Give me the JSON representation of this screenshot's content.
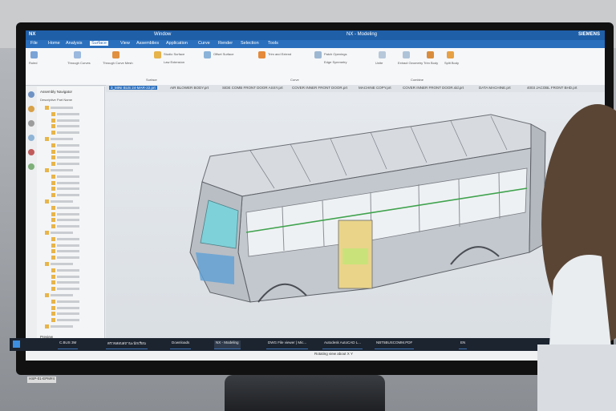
{
  "window": {
    "app_badge": "NX",
    "title": "NX - Modeling",
    "brand": "SIEMENS",
    "window_menu": "Window"
  },
  "menu": [
    "File",
    "Home",
    "Analysis",
    "Surface",
    "View",
    "Assemblies",
    "Application",
    "Curve",
    "Render",
    "Selection",
    "Tools"
  ],
  "ribbon": {
    "groups": [
      "Surface",
      "Curve",
      "Combine"
    ],
    "labels": [
      "Ruled",
      "Through Curves",
      "Through Curve Mesh",
      "Studio Surface",
      "Law Extension",
      "Offset Surface",
      "Trim and Extend",
      "Patch Openings",
      "Edge Symmetry",
      "Unite",
      "Extract Geometry",
      "Trim Body",
      "Split Body"
    ]
  },
  "file_tabs": [
    "3_MINI BUS 24-MAR-22.prt",
    "AIR BLOWER BODY.prt",
    "SIDE COMB FRONT DOOR ASSY.prt",
    "COVER INNER FRONT DOOR.prt",
    "MACHINE COPY.prt",
    "COVER INNER FRONT DOOR.sld.prt",
    "DATA MACHINE.prt",
    "4003 JACOBL FRONT BHD.prt"
  ],
  "nav": {
    "title": "Assembly Navigator",
    "subtitle": "Descriptive Part Name",
    "preview": "Preview",
    "dependencies": "Dependencies"
  },
  "status": {
    "text": "Rotating view about X Y"
  },
  "taskbar": {
    "items": [
      "C.BUS 3M",
      "ตรวจสอบสถานะนักเรียน",
      "Downloads",
      "NX - Modeling",
      "DWG File viewer | Mic...",
      "Autodesk AutoCAD L...",
      "NBT5BUSCOMM.PDF"
    ],
    "clock": "29°C  ฝนตกปานกลาง",
    "lang": "EN"
  },
  "sticker": "HSP-01-EPM#4",
  "colors": {
    "title_blue": "#1f5fa8",
    "menu_blue": "#2a6fbd",
    "viewport_bg": "#e2e6ea",
    "bus_body": "#cfd3d8"
  }
}
